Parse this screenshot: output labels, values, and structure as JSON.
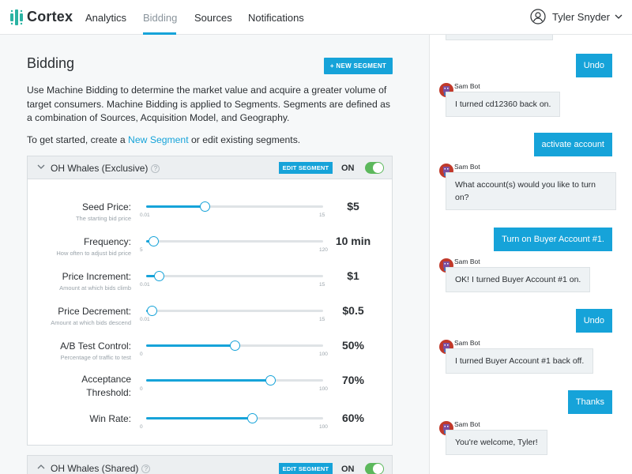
{
  "brand": {
    "name": "Cortex",
    "accent": "#16a3d9"
  },
  "nav": {
    "items": [
      {
        "label": "Analytics"
      },
      {
        "label": "Bidding",
        "active": true
      },
      {
        "label": "Sources"
      },
      {
        "label": "Notifications"
      }
    ],
    "user": {
      "name": "Tyler Snyder",
      "icon": "user-circle-icon"
    }
  },
  "page": {
    "title": "Bidding",
    "new_segment_button": "+ NEW SEGMENT",
    "intro": "Use Machine Bidding to determine the market value and acquire a greater volume of target consumers. Machine Bidding is applied to Segments. Segments are defined as a combination of Sources, Acquisition Model, and Geography.",
    "get_started_prefix": "To get started, create a ",
    "get_started_link": "New Segment",
    "get_started_suffix": " or edit existing segments."
  },
  "segments": [
    {
      "name": "OH Whales (Exclusive)",
      "edit_label": "EDIT SEGMENT",
      "status": "ON",
      "expanded": true,
      "sliders": [
        {
          "label": "Seed Price:",
          "sub": "The starting bid price",
          "min": "0.01",
          "max": "15",
          "value": "$5",
          "fraction": 0.33
        },
        {
          "label": "Frequency:",
          "sub": "How often to adjust bid price",
          "min": "5",
          "max": "120",
          "value": "10 min",
          "fraction": 0.04
        },
        {
          "label": "Price Increment:",
          "sub": "Amount at which bids climb",
          "min": "0.01",
          "max": "15",
          "value": "$1",
          "fraction": 0.07
        },
        {
          "label": "Price Decrement:",
          "sub": "Amount at which bids descend",
          "min": "0.01",
          "max": "15",
          "value": "$0.5",
          "fraction": 0.03
        },
        {
          "label": "A/B Test Control:",
          "sub": "Percentage of traffic to test",
          "min": "0",
          "max": "100",
          "value": "50%",
          "fraction": 0.5
        },
        {
          "label": "Acceptance Threshold:",
          "sub": "",
          "min": "0",
          "max": "100",
          "value": "70%",
          "fraction": 0.7
        },
        {
          "label": "Win Rate:",
          "sub": "",
          "min": "0",
          "max": "100",
          "value": "60%",
          "fraction": 0.6
        }
      ]
    },
    {
      "name": "OH Whales (Shared)",
      "edit_label": "EDIT SEGMENT",
      "status": "ON",
      "expanded": false
    }
  ],
  "chat": {
    "messages": [
      {
        "from": "user",
        "text": "Undo"
      },
      {
        "from": "bot",
        "name": "Sam Bot",
        "text": "I turned cd12360 back on."
      },
      {
        "from": "user",
        "text": "activate account"
      },
      {
        "from": "bot",
        "name": "Sam Bot",
        "text": "What account(s) would you like to turn on?"
      },
      {
        "from": "user",
        "text": "Turn on Buyer Account #1."
      },
      {
        "from": "bot",
        "name": "Sam Bot",
        "text": "OK! I turned Buyer Account #1 on."
      },
      {
        "from": "user",
        "text": "Undo"
      },
      {
        "from": "bot",
        "name": "Sam Bot",
        "text": "I turned Buyer Account #1 back off."
      },
      {
        "from": "user",
        "text": "Thanks"
      },
      {
        "from": "bot",
        "name": "Sam Bot",
        "text": "You're welcome, Tyler!"
      }
    ]
  }
}
